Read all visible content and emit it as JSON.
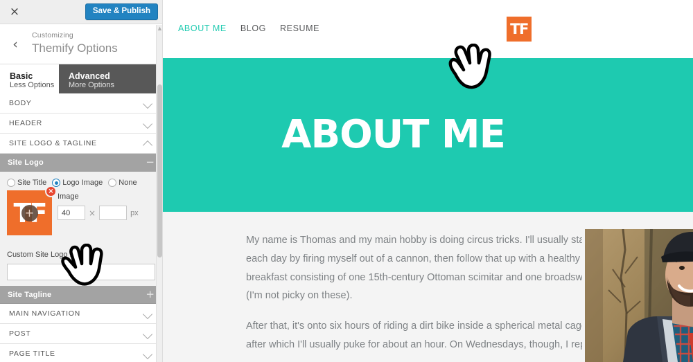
{
  "customizer": {
    "close_icon": "×",
    "close_label": "Close customizer",
    "save_label": "Save & Publish",
    "back_icon": "‹",
    "breadcrumb_label": "Customizing",
    "panel_title": "Themify Options",
    "tabs": [
      {
        "main": "Basic",
        "sub": "Less Options",
        "active": true
      },
      {
        "main": "Advanced",
        "sub": "More Options",
        "active": false
      }
    ],
    "sections": [
      {
        "label": "BODY",
        "expanded": false
      },
      {
        "label": "HEADER",
        "expanded": false
      },
      {
        "label": "SITE LOGO & TAGLINE",
        "expanded": true
      }
    ],
    "site_logo": {
      "bar_label": "Site Logo",
      "bar_icon": "−",
      "options": [
        {
          "label": "Site Title",
          "checked": false
        },
        {
          "label": "Logo Image",
          "checked": true
        },
        {
          "label": "None",
          "checked": false
        }
      ],
      "logo_mark": "TF",
      "logo_remove_icon": "×",
      "logo_add_icon": "+",
      "image_label": "Image",
      "width_value": "40",
      "height_value": "",
      "unit_label": "px",
      "custom_link_label": "Custom Site Logo Link",
      "custom_link_value": ""
    },
    "site_tagline": {
      "bar_label": "Site Tagline",
      "bar_icon": "+"
    },
    "sections_below": [
      {
        "label": "MAIN NAVIGATION",
        "expanded": false
      },
      {
        "label": "POST",
        "expanded": false
      },
      {
        "label": "PAGE TITLE",
        "expanded": false
      }
    ]
  },
  "preview": {
    "nav": [
      {
        "label": "ABOUT ME",
        "active": true
      },
      {
        "label": "BLOG",
        "active": false
      },
      {
        "label": "RESUME",
        "active": false
      }
    ],
    "logo_mark": "TF",
    "hero_title": "ABOUT ME",
    "paragraphs": [
      "My name is Thomas and my main hobby is doing circus tricks. I'll usually start each day by firing myself out of a cannon, then follow that up with a healthy breakfast consisting of one 15th-century Ottoman scimitar and one broadsword (I'm not picky on these).",
      "After that, it's onto six hours of riding a dirt bike inside a spherical metal cage, after which I'll usually puke for about an hour. On Wednesdays, though, I replace"
    ],
    "photo_alt": "Portrait photo of a bearded man wearing a cap"
  },
  "colors": {
    "teal_accent": "#1ecab0",
    "orange_logo": "#ef6e2b",
    "save_button_blue": "#2283c1",
    "radio_blue": "#2283c1",
    "remove_badge_red": "#e8462f",
    "tab_bar_gray": "#585858",
    "sub_bar_gray": "#a3a3a3",
    "content_bg": "#f4f4f4"
  }
}
